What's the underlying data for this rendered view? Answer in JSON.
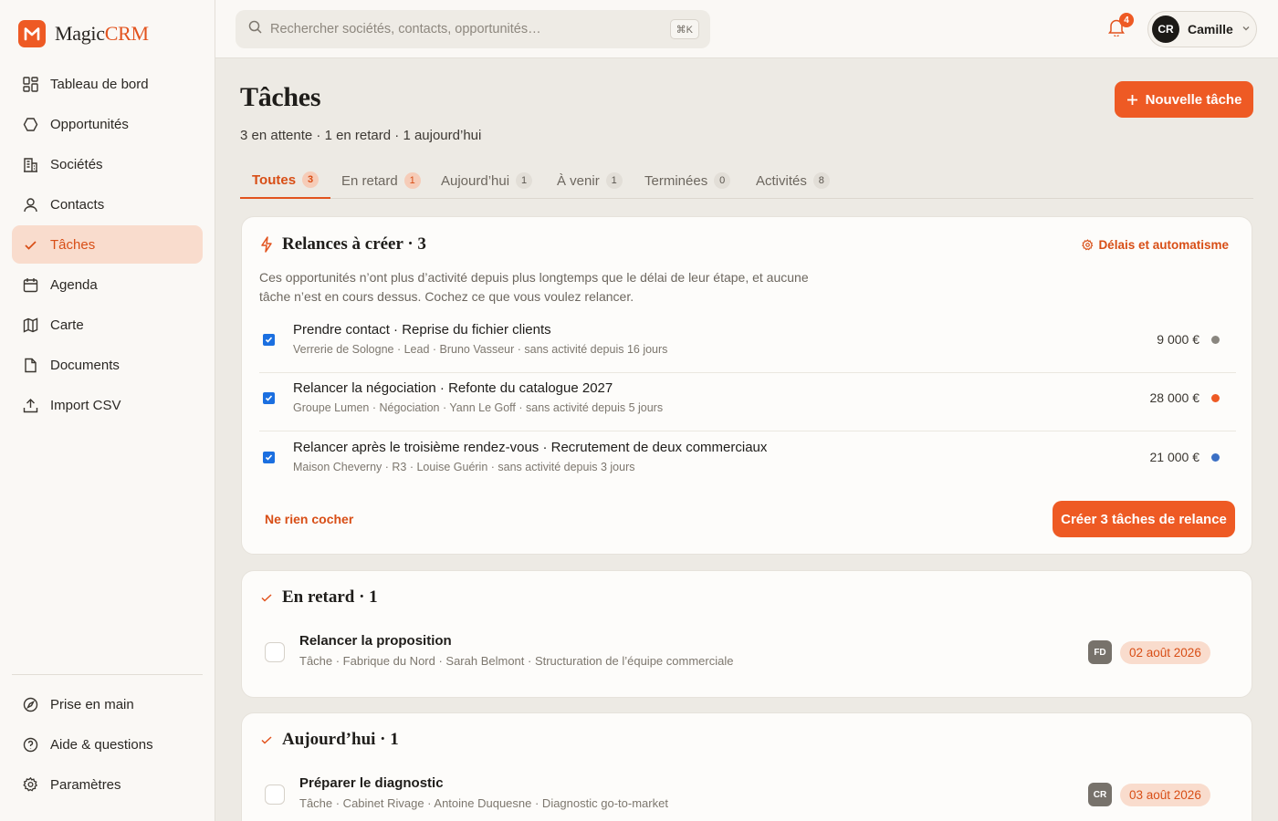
{
  "app": {
    "name_main": "Magic",
    "name_accent": "CRM",
    "accent": "#ee5a24"
  },
  "nav": {
    "items": [
      {
        "label": "Tableau de bord",
        "icon": "dashboard-icon"
      },
      {
        "label": "Opportunités",
        "icon": "hexagon-icon"
      },
      {
        "label": "Sociétés",
        "icon": "building-icon"
      },
      {
        "label": "Contacts",
        "icon": "user-icon"
      },
      {
        "label": "Tâches",
        "icon": "check-icon",
        "active": true
      },
      {
        "label": "Agenda",
        "icon": "calendar-icon"
      },
      {
        "label": "Carte",
        "icon": "map-icon"
      },
      {
        "label": "Documents",
        "icon": "document-icon"
      },
      {
        "label": "Import CSV",
        "icon": "upload-icon"
      }
    ],
    "bottom": [
      {
        "label": "Prise en main",
        "icon": "compass-icon"
      },
      {
        "label": "Aide & questions",
        "icon": "help-icon"
      },
      {
        "label": "Paramètres",
        "icon": "gear-icon"
      }
    ]
  },
  "topbar": {
    "search_placeholder": "Rechercher sociétés, contacts, opportunités…",
    "shortcut": "⌘K",
    "notifications": "4",
    "user_initials": "CR",
    "user_name": "Camille"
  },
  "page": {
    "title": "Tâches",
    "subtitle": "3 en attente · 1 en retard · 1 aujourd’hui",
    "new_button": "Nouvelle tâche"
  },
  "tabs": [
    {
      "label": "Toutes",
      "count": "3",
      "active": true
    },
    {
      "label": "En retard",
      "count": "1",
      "red": true
    },
    {
      "label": "Aujourd’hui",
      "count": "1"
    },
    {
      "label": "À venir",
      "count": "1"
    },
    {
      "label": "Terminées",
      "count": "0"
    },
    {
      "label": "Activités",
      "count": "8"
    }
  ],
  "relances": {
    "title": "Relances à créer · 3",
    "settings_link": "Délais et automatisme",
    "description": "Ces opportunités n’ont plus d’activité depuis plus longtemps que le délai de leur étape, et aucune tâche n’est en cours dessus. Cochez ce que vous voulez relancer.",
    "items": [
      {
        "title": "Prendre contact · Reprise du fichier clients",
        "meta": "Verrerie de Sologne · Lead · Bruno Vasseur · sans activité depuis 16 jours",
        "amount": "9 000 €",
        "dot": "#8a867f",
        "checked": true
      },
      {
        "title": "Relancer la négociation · Refonte du catalogue 2027",
        "meta": "Groupe Lumen · Négociation · Yann Le Goff · sans activité depuis 5 jours",
        "amount": "28 000 €",
        "dot": "#ee5a24",
        "checked": true
      },
      {
        "title": "Relancer après le troisième rendez-vous · Recrutement de deux commerciaux",
        "meta": "Maison Cheverny · R3 · Louise Guérin · sans activité depuis 3 jours",
        "amount": "21 000 €",
        "dot": "#3b6fc4",
        "checked": true
      }
    ],
    "clear_link": "Ne rien cocher",
    "create_button": "Créer 3 tâches de relance"
  },
  "late": {
    "title": "En retard · 1",
    "items": [
      {
        "title": "Relancer la proposition",
        "meta": "Tâche · Fabrique du Nord · Sarah Belmont · Structuration de l’équipe commerciale",
        "owner": "FD",
        "date": "02 août 2026"
      }
    ]
  },
  "today": {
    "title": "Aujourd’hui · 1",
    "items": [
      {
        "title": "Préparer le diagnostic",
        "meta": "Tâche · Cabinet Rivage · Antoine Duquesne · Diagnostic go-to-market",
        "owner": "CR",
        "date": "03 août 2026"
      }
    ]
  }
}
